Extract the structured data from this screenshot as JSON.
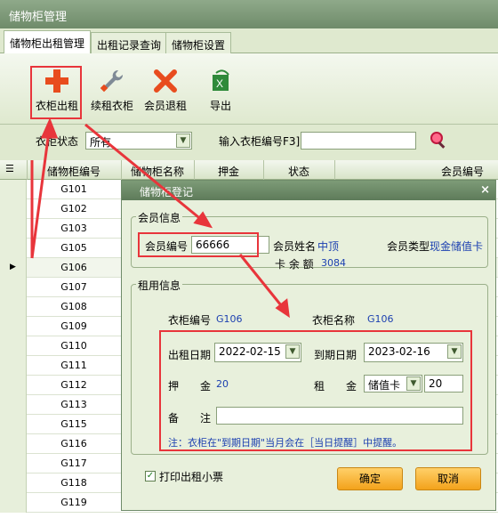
{
  "window": {
    "title": "储物柜管理"
  },
  "tabs": [
    {
      "label": "储物柜出租管理"
    },
    {
      "label": "出租记录查询"
    },
    {
      "label": "储物柜设置"
    }
  ],
  "toolbar": {
    "rent": "衣柜出租",
    "renew": "续租衣柜",
    "return": "会员退租",
    "export": "导出"
  },
  "filter": {
    "status_label": "衣柜状态",
    "status_value": "所有",
    "search_label": "输入衣柜编号F3]",
    "search_value": ""
  },
  "grid": {
    "headers": [
      "储物柜编号",
      "储物柜名称",
      "押金",
      "状态",
      "会员编号"
    ],
    "rows": [
      "G101",
      "G102",
      "G103",
      "G105",
      "G106",
      "G107",
      "G108",
      "G109",
      "G110",
      "G111",
      "G112",
      "G113",
      "G115",
      "G116",
      "G117",
      "G118",
      "G119"
    ],
    "selected": "G106"
  },
  "dialog": {
    "title": "储物柜登记",
    "member_section": "会员信息",
    "member_id_label": "会员编号",
    "member_id_value": "66666",
    "member_name_label": "会员姓名",
    "member_name_value": "中顶",
    "member_type_label": "会员类型",
    "member_type_value": "现金储值卡",
    "balance_label": "卡 余 额",
    "balance_value": "3084",
    "rent_section": "租用信息",
    "locker_id_label": "衣柜编号",
    "locker_id_value": "G106",
    "locker_name_label": "衣柜名称",
    "locker_name_value": "G106",
    "start_date_label": "出租日期",
    "start_date_value": "2022-02-15",
    "end_date_label": "到期日期",
    "end_date_value": "2023-02-16",
    "deposit_label": "押　　金",
    "deposit_value": "20",
    "rent_label": "租　　金",
    "rent_pay_value": "储值卡",
    "rent_amount_value": "20",
    "note_label": "备　　注",
    "note_value": "",
    "hint": "注：衣柜在\"到期日期\"当月会在［当日提醒］中提醒。",
    "print_label": "打印出租小票",
    "ok": "确定",
    "cancel": "取消"
  }
}
